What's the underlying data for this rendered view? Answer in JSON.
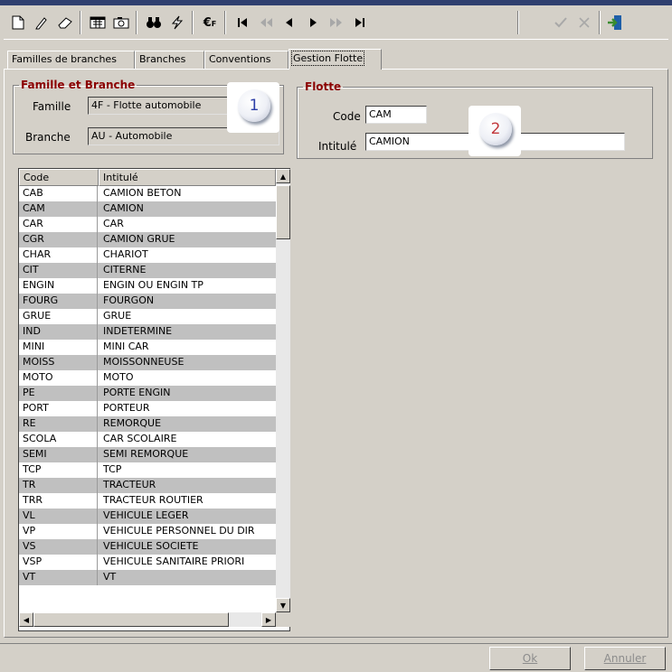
{
  "toolbar": {
    "icons": [
      "new-icon",
      "edit-pencil-icon",
      "eraser-icon",
      "calendar-icon",
      "camera-icon",
      "binoculars-icon",
      "lightning-icon",
      "euro-icon",
      "first-record-icon",
      "fast-back-icon",
      "previous-icon",
      "next-icon",
      "fast-forward-icon",
      "last-record-icon",
      "validate-check-icon",
      "cancel-x-icon",
      "exit-door-icon"
    ]
  },
  "tabs": [
    {
      "label": "Familles de branches"
    },
    {
      "label": "Branches"
    },
    {
      "label": "Conventions"
    },
    {
      "label": "Gestion Flotte"
    }
  ],
  "famille_branche": {
    "title": "Famille et Branche",
    "famille_label": "Famille",
    "famille_value": "4F - Flotte automobile",
    "branche_label": "Branche",
    "branche_value": "AU - Automobile",
    "badge": "1"
  },
  "flotte": {
    "title": "Flotte",
    "code_label": "Code",
    "code_value": "CAM",
    "intitule_label": "Intitulé",
    "intitule_value": "CAMION",
    "badge": "2"
  },
  "grid": {
    "headers": [
      "Code",
      "Intitulé"
    ],
    "rows": [
      [
        "CAB",
        "CAMION BETON"
      ],
      [
        "CAM",
        "CAMION"
      ],
      [
        "CAR",
        "CAR"
      ],
      [
        "CGR",
        "CAMION GRUE"
      ],
      [
        "CHAR",
        "CHARIOT"
      ],
      [
        "CIT",
        "CITERNE"
      ],
      [
        "ENGIN",
        "ENGIN  OU ENGIN TP"
      ],
      [
        "FOURG",
        "FOURGON"
      ],
      [
        "GRUE",
        "GRUE"
      ],
      [
        "IND",
        "INDETERMINE"
      ],
      [
        "MINI",
        "MINI CAR"
      ],
      [
        "MOISS",
        "MOISSONNEUSE"
      ],
      [
        "MOTO",
        "MOTO"
      ],
      [
        "PE",
        "PORTE ENGIN"
      ],
      [
        "PORT",
        "PORTEUR"
      ],
      [
        "RE",
        "REMORQUE"
      ],
      [
        "SCOLA",
        "CAR SCOLAIRE"
      ],
      [
        "SEMI",
        "SEMI REMORQUE"
      ],
      [
        "TCP",
        "TCP"
      ],
      [
        "TR",
        "TRACTEUR"
      ],
      [
        "TRR",
        "TRACTEUR ROUTIER"
      ],
      [
        "VL",
        "VEHICULE LEGER"
      ],
      [
        "VP",
        "VEHICULE PERSONNEL DU DIR"
      ],
      [
        "VS",
        "VEHICULE SOCIETE"
      ],
      [
        "VSP",
        "VEHICULE SANITAIRE PRIORI"
      ],
      [
        "VT",
        "VT"
      ]
    ]
  },
  "buttons": {
    "ok_label": "Ok",
    "annuler_label": "Annuler"
  }
}
